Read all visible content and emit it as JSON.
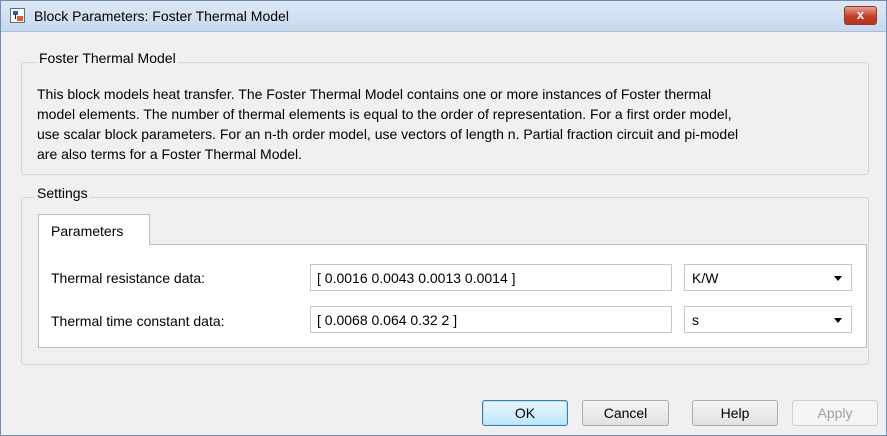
{
  "window": {
    "title": "Block Parameters: Foster Thermal Model",
    "close_label": "x"
  },
  "description_group": {
    "label": "Foster Thermal Model",
    "lines": [
      "This block models heat transfer. The Foster Thermal Model contains one or more instances of Foster thermal",
      "model elements. The number of thermal elements is equal to the order of representation. For a first order model,",
      "use scalar block parameters. For an n-th order model, use vectors of length n. Partial fraction circuit and pi-model",
      "are also terms for a Foster Thermal Model."
    ]
  },
  "settings": {
    "label": "Settings",
    "tabs": [
      {
        "label": "Parameters",
        "active": true
      }
    ],
    "parameters": [
      {
        "label": "Thermal resistance data:",
        "value": "[ 0.0016 0.0043 0.0013 0.0014 ]",
        "unit": "K/W"
      },
      {
        "label": "Thermal time constant data:",
        "value": "[ 0.0068 0.064 0.32 2 ]",
        "unit": "s"
      }
    ]
  },
  "buttons": {
    "ok": "OK",
    "cancel": "Cancel",
    "help": "Help",
    "apply": "Apply"
  },
  "colors": {
    "close_button": "#c5402a",
    "default_button_border": "#3c7fb1",
    "disabled_text": "#a0a0a0"
  }
}
